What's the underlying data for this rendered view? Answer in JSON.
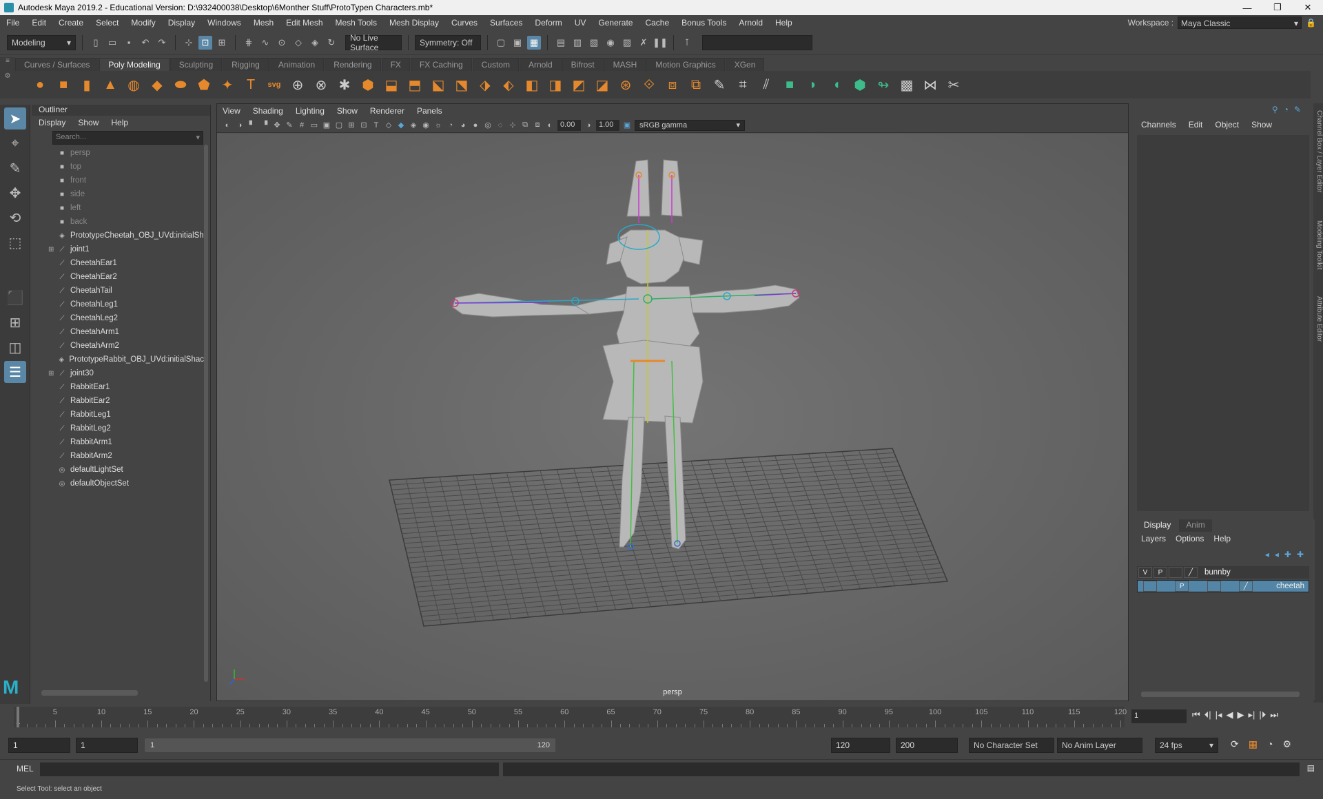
{
  "window": {
    "title": "Autodesk Maya 2019.2 - Educational Version: D:\\932400038\\Desktop\\6Monther Stuff\\ProtoTypen Characters.mb*",
    "minimize": "—",
    "maximize": "❐",
    "close": "✕"
  },
  "menus": [
    "File",
    "Edit",
    "Create",
    "Select",
    "Modify",
    "Display",
    "Windows",
    "Mesh",
    "Edit Mesh",
    "Mesh Tools",
    "Mesh Display",
    "Curves",
    "Surfaces",
    "Deform",
    "UV",
    "Generate",
    "Cache",
    "Bonus Tools",
    "Arnold",
    "Help"
  ],
  "workspace": {
    "label": "Workspace :",
    "value": "Maya Classic"
  },
  "statusline": {
    "menuset": "Modeling",
    "live_surface": "No Live Surface",
    "symmetry": "Symmetry: Off"
  },
  "shelf": {
    "tabs": [
      "Curves / Surfaces",
      "Poly Modeling",
      "Sculpting",
      "Rigging",
      "Animation",
      "Rendering",
      "FX",
      "FX Caching",
      "Custom",
      "Arnold",
      "Bifrost",
      "MASH",
      "Motion Graphics",
      "XGen"
    ],
    "active_tab": "Poly Modeling"
  },
  "outliner": {
    "title": "Outliner",
    "menus": [
      "Display",
      "Show",
      "Help"
    ],
    "search_placeholder": "Search...",
    "items": [
      {
        "label": "persp",
        "type": "camera",
        "dim": true
      },
      {
        "label": "top",
        "type": "camera",
        "dim": true
      },
      {
        "label": "front",
        "type": "camera",
        "dim": true
      },
      {
        "label": "side",
        "type": "camera",
        "dim": true
      },
      {
        "label": "left",
        "type": "camera",
        "dim": true
      },
      {
        "label": "back",
        "type": "camera",
        "dim": true
      },
      {
        "label": "PrototypeCheetah_OBJ_UVd:initialSh",
        "type": "mesh"
      },
      {
        "label": "joint1",
        "type": "joint",
        "expand": true
      },
      {
        "label": "CheetahEar1",
        "type": "joint"
      },
      {
        "label": "CheetahEar2",
        "type": "joint"
      },
      {
        "label": "CheetahTail",
        "type": "joint"
      },
      {
        "label": "CheetahLeg1",
        "type": "joint"
      },
      {
        "label": "CheetahLeg2",
        "type": "joint"
      },
      {
        "label": "CheetahArm1",
        "type": "joint"
      },
      {
        "label": "CheetahArm2",
        "type": "joint"
      },
      {
        "label": "PrototypeRabbit_OBJ_UVd:initialShac",
        "type": "mesh"
      },
      {
        "label": "joint30",
        "type": "joint",
        "expand": true
      },
      {
        "label": "RabbitEar1",
        "type": "joint"
      },
      {
        "label": "RabbitEar2",
        "type": "joint"
      },
      {
        "label": "RabbitLeg1",
        "type": "joint"
      },
      {
        "label": "RabbitLeg2",
        "type": "joint"
      },
      {
        "label": "RabbitArm1",
        "type": "joint"
      },
      {
        "label": "RabbitArm2",
        "type": "joint"
      },
      {
        "label": "defaultLightSet",
        "type": "set"
      },
      {
        "label": "defaultObjectSet",
        "type": "set"
      }
    ]
  },
  "viewport": {
    "menus": [
      "View",
      "Shading",
      "Lighting",
      "Show",
      "Renderer",
      "Panels"
    ],
    "exposure": "0.00",
    "gamma": "1.00",
    "colorspace": "sRGB gamma",
    "camera_label": "persp"
  },
  "channelbox": {
    "menus": [
      "Channels",
      "Edit",
      "Object",
      "Show"
    ]
  },
  "sidetabs": [
    "Channel Box / Layer Editor",
    "Modeling Toolkit",
    "Attribute Editor"
  ],
  "layers": {
    "tabs": [
      "Display",
      "Anim"
    ],
    "menus": [
      "Layers",
      "Options",
      "Help"
    ],
    "rows": [
      {
        "v": "V",
        "p": "P",
        "name": "bunnby",
        "selected": false
      },
      {
        "v": "",
        "p": "P",
        "name": "cheetah",
        "selected": true
      }
    ]
  },
  "timeline": {
    "ticks": [
      1,
      5,
      10,
      15,
      20,
      25,
      30,
      35,
      40,
      45,
      50,
      55,
      60,
      65,
      70,
      75,
      80,
      85,
      90,
      95,
      100,
      105,
      110,
      115,
      120
    ],
    "range_min": 1,
    "range_max": 120,
    "current_frame": "1"
  },
  "range": {
    "start": "1",
    "inner_start": "1",
    "bar_start": "1",
    "bar_end": "120",
    "end": "120",
    "outer_end": "200",
    "character_set": "No Character Set",
    "anim_layer": "No Anim Layer",
    "fps": "24 fps"
  },
  "commandline": {
    "label": "MEL"
  },
  "helpline": {
    "text": "Select Tool: select an object"
  }
}
